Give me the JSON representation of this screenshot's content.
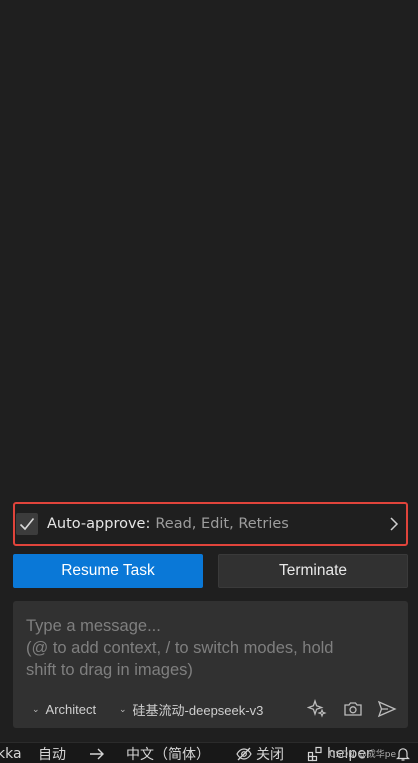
{
  "auto_approve": {
    "title": "Auto-approve:",
    "options": "Read, Edit, Retries",
    "checked": true,
    "highlight_color": "#e0443b"
  },
  "actions": {
    "resume_label": "Resume Task",
    "terminate_label": "Terminate",
    "primary_color": "#0a78d7"
  },
  "composer": {
    "placeholder_line1": "Type a message...",
    "placeholder_line2": "(@ to add context, / to switch modes, hold",
    "placeholder_line3": "shift to drag in images)",
    "mode": "Architect",
    "model": "硅基流动-deepseek-v3",
    "icons": [
      "sparkle-icon",
      "camera-icon",
      "send-icon"
    ]
  },
  "status_bar": {
    "item1": "kka",
    "item2": "自动",
    "item3_icon": "arrow-right-icon",
    "item4": "中文（简体）",
    "item5": "关闭",
    "item5_icon": "eye-off-icon",
    "item6": "helper",
    "item6_icon": "extensions-icon",
    "watermark": "CSDN @成华pe",
    "bell_icon": "bell-icon"
  }
}
